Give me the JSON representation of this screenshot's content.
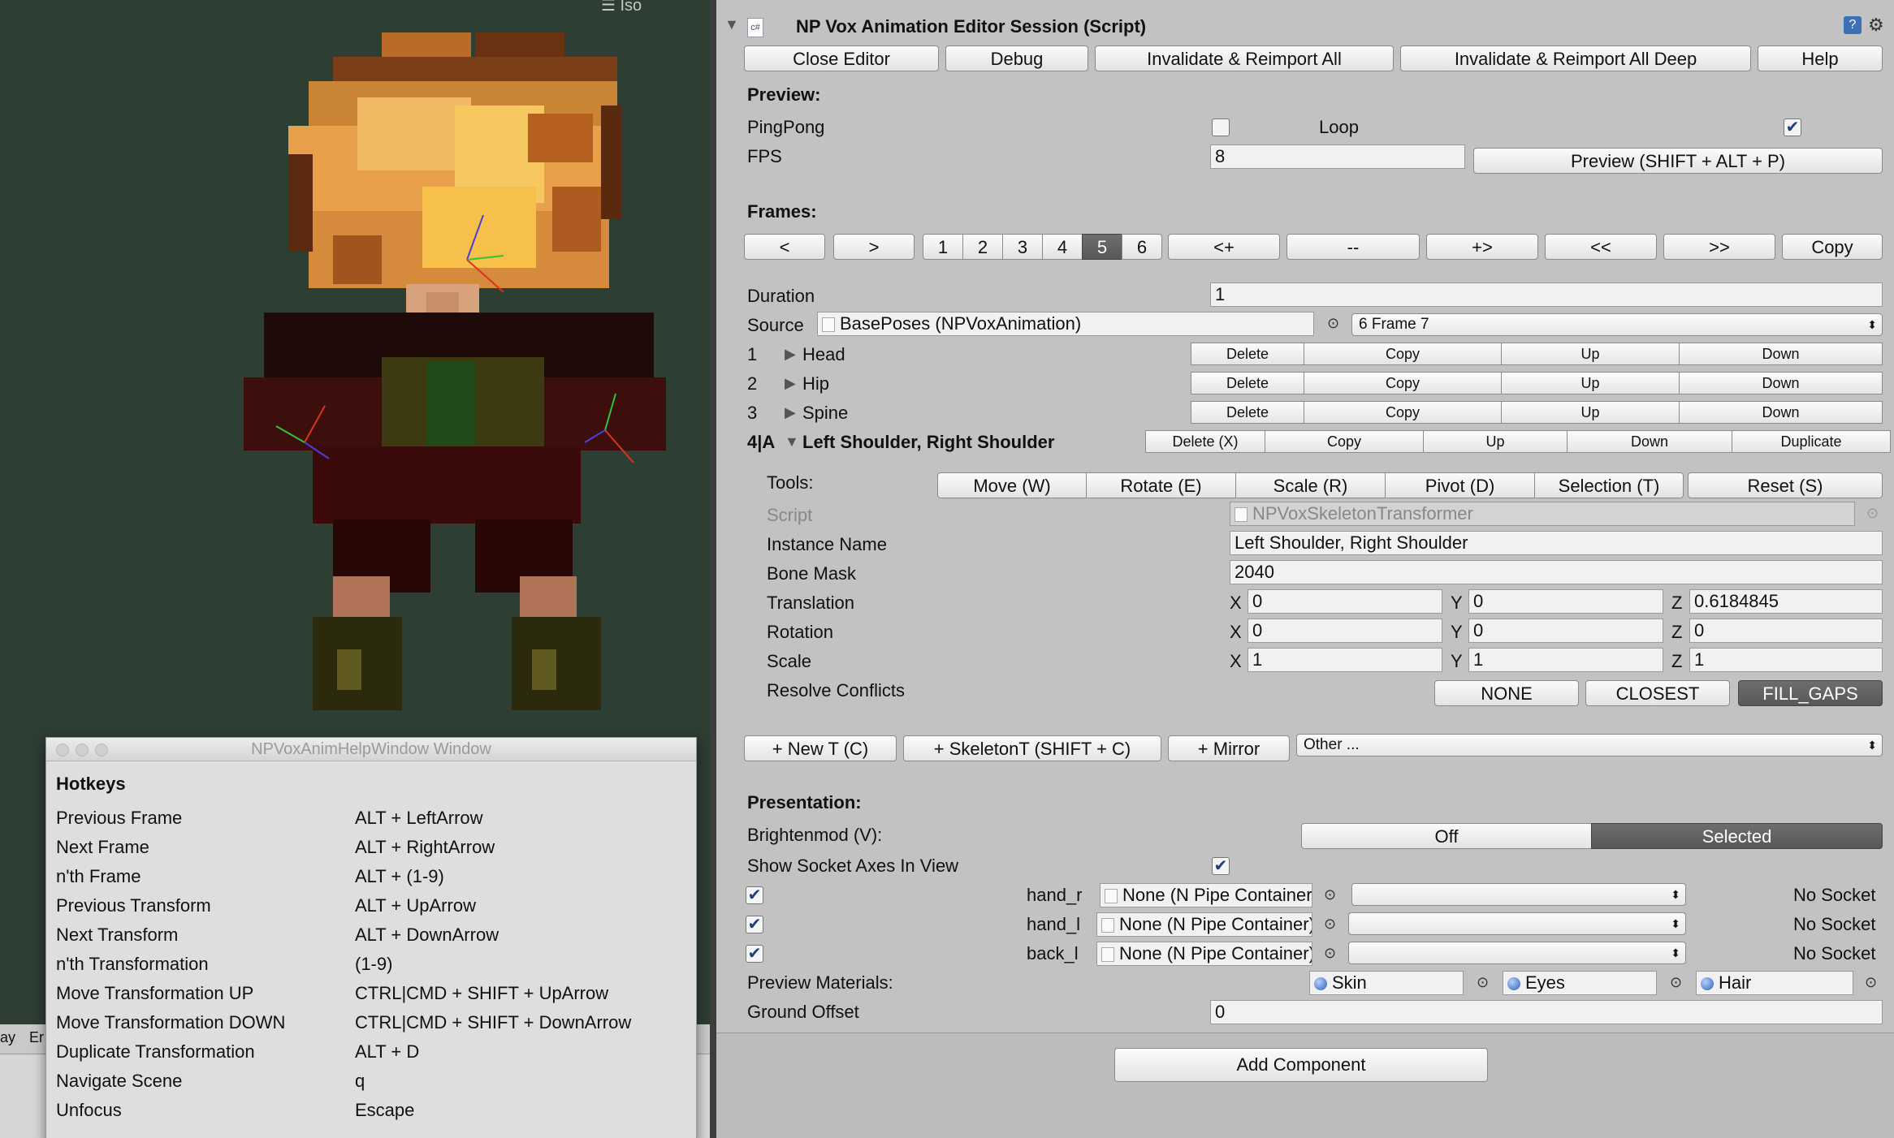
{
  "scene": {
    "view_label": "Iso"
  },
  "help_window": {
    "title": "NPVoxAnimHelpWindow Window",
    "heading": "Hotkeys",
    "hotkeys": [
      {
        "action": "Previous Frame",
        "keys": "ALT + LeftArrow"
      },
      {
        "action": "Next Frame",
        "keys": "ALT + RightArrow"
      },
      {
        "action": "n'th Frame",
        "keys": "ALT + (1-9)"
      },
      {
        "action": "Previous Transform",
        "keys": "ALT + UpArrow"
      },
      {
        "action": "Next Transform",
        "keys": "ALT + DownArrow"
      },
      {
        "action": "n'th Transformation",
        "keys": "(1-9)"
      },
      {
        "action": "Move Transformation UP",
        "keys": "CTRL|CMD + SHIFT + UpArrow"
      },
      {
        "action": "Move Transformation DOWN",
        "keys": "CTRL|CMD + SHIFT + DownArrow"
      },
      {
        "action": "Duplicate Transformation",
        "keys": "ALT + D"
      },
      {
        "action": "Navigate Scene",
        "keys": "q"
      },
      {
        "action": "Unfocus",
        "keys": "Escape"
      }
    ]
  },
  "bottom_tabs": [
    "ay",
    "Er"
  ],
  "inspector": {
    "component_title": "NP Vox Animation Editor Session (Script)",
    "top_buttons": [
      "Close Editor",
      "Debug",
      "Invalidate & Reimport All",
      "Invalidate & Reimport All Deep",
      "Help"
    ],
    "preview": {
      "heading": "Preview:",
      "pingpong_label": "PingPong",
      "pingpong_checked": false,
      "loop_label": "Loop",
      "loop_checked": true,
      "fps_label": "FPS",
      "fps_value": "8",
      "preview_button": "Preview (SHIFT + ALT + P)"
    },
    "frames": {
      "heading": "Frames:",
      "prev": "<",
      "next": ">",
      "numbers": [
        "1",
        "2",
        "3",
        "4",
        "5",
        "6"
      ],
      "selected": "5",
      "actions": [
        "<+",
        "--",
        "+>",
        "<<",
        ">>",
        "Copy"
      ]
    },
    "duration_label": "Duration",
    "duration_value": "1",
    "source_label": "Source",
    "source_value": "BasePoses (NPVoxAnimation)",
    "source_frame": "6 Frame 7",
    "transforms": [
      {
        "index": "1",
        "name": "Head"
      },
      {
        "index": "2",
        "name": "Hip"
      },
      {
        "index": "3",
        "name": "Spine"
      }
    ],
    "row_buttons": [
      "Delete",
      "Copy",
      "Up",
      "Down"
    ],
    "active_transform": {
      "index": "4|A",
      "name": "Left Shoulder, Right Shoulder",
      "buttons": [
        "Delete (X)",
        "Copy",
        "Up",
        "Down",
        "Duplicate"
      ]
    },
    "tools_label": "Tools:",
    "tools": [
      "Move (W)",
      "Rotate (E)",
      "Scale (R)",
      "Pivot (D)",
      "Selection (T)"
    ],
    "reset_button": "Reset (S)",
    "script_label": "Script",
    "script_value": "NPVoxSkeletonTransformer",
    "instance_name_label": "Instance Name",
    "instance_name_value": "Left Shoulder, Right Shoulder",
    "bone_mask_label": "Bone Mask",
    "bone_mask_value": "2040",
    "axis": {
      "x": "X",
      "y": "Y",
      "z": "Z"
    },
    "translation": {
      "label": "Translation",
      "x": "0",
      "y": "0",
      "z": "0.6184845"
    },
    "rotation": {
      "label": "Rotation",
      "x": "0",
      "y": "0",
      "z": "0"
    },
    "scale": {
      "label": "Scale",
      "x": "1",
      "y": "1",
      "z": "1"
    },
    "resolve_label": "Resolve Conflicts",
    "resolve_options": [
      "NONE",
      "CLOSEST",
      "FILL_GAPS"
    ],
    "resolve_selected": "FILL_GAPS",
    "add_buttons": [
      "+ New T (C)",
      "+ SkeletonT (SHIFT + C)",
      "+ Mirror"
    ],
    "other_dropdown": "Other ...",
    "presentation": {
      "heading": "Presentation:",
      "brightenmod_label": "Brightenmod (V):",
      "brightenmod_options": [
        "Off",
        "Selected"
      ],
      "brightenmod_selected": "Selected",
      "socket_axes_label": "Show Socket Axes In View",
      "socket_axes_checked": true,
      "sockets": [
        {
          "name": "hand_r",
          "object": "None (N Pipe Container)",
          "status": "No Socket",
          "checked": true
        },
        {
          "name": "hand_l",
          "object": "None (N Pipe Container)",
          "status": "No Socket",
          "checked": true
        },
        {
          "name": "back_l",
          "object": "None (N Pipe Container)",
          "status": "No Socket",
          "checked": true
        }
      ],
      "materials_label": "Preview Materials:",
      "materials": [
        "Skin",
        "Eyes",
        "Hair"
      ],
      "ground_offset_label": "Ground Offset",
      "ground_offset_value": "0"
    },
    "add_component": "Add Component"
  }
}
